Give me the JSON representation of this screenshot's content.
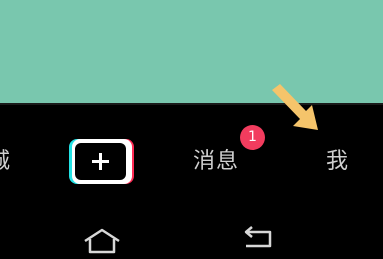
{
  "bottom_nav": {
    "tab_partial_label": "城",
    "create_icon": "plus-icon",
    "messages_label": "消息",
    "messages_badge": "1",
    "me_label": "我"
  },
  "overlay": {
    "icon": "pointing-arrow-icon",
    "color": "#F5C46B"
  },
  "system_nav": {
    "home_icon": "home-icon",
    "back_icon": "back-icon"
  },
  "colors": {
    "content_bg": "#79C7AE",
    "bar_bg": "#000000",
    "badge": "#F23C5E",
    "create_cyan": "#23E3E6",
    "create_red": "#FF2C55"
  }
}
